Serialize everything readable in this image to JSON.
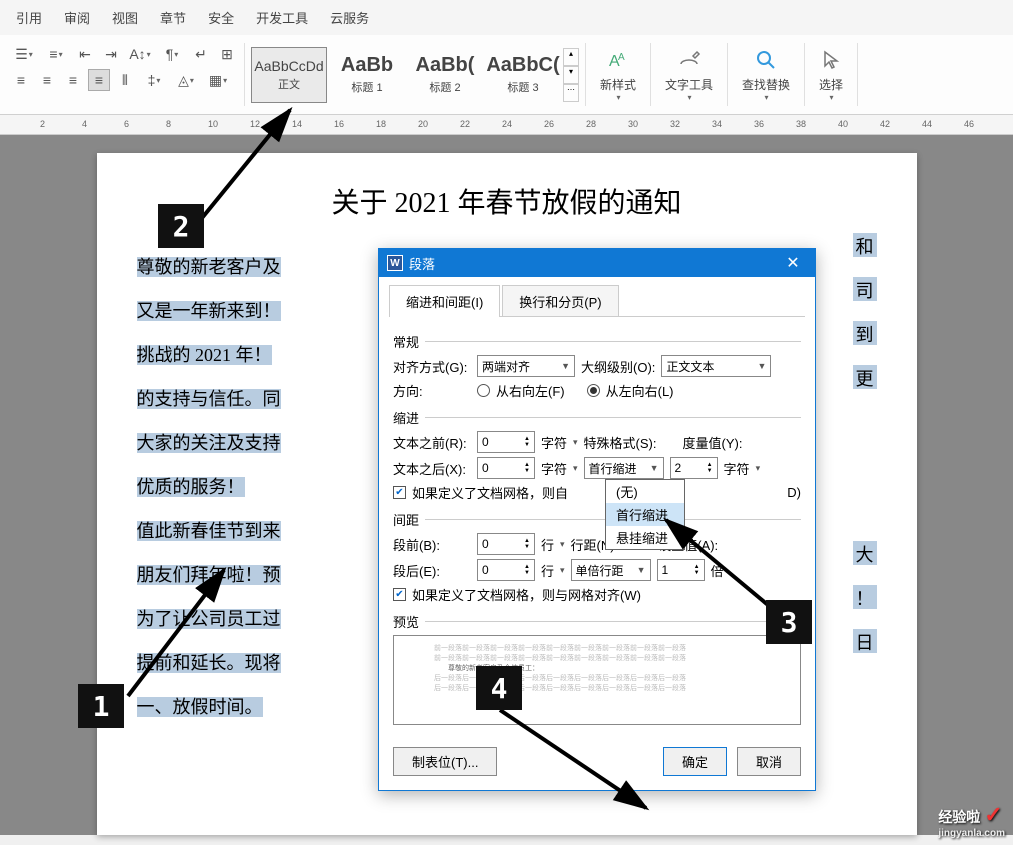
{
  "menubar": [
    "引用",
    "审阅",
    "视图",
    "章节",
    "安全",
    "开发工具",
    "云服务"
  ],
  "ribbon": {
    "styles": [
      {
        "sample": "AaBbCcDd",
        "label": "正文",
        "active": true
      },
      {
        "sample": "AaBb",
        "label": "标题 1",
        "big": true
      },
      {
        "sample": "AaBb(",
        "label": "标题 2",
        "big": true
      },
      {
        "sample": "AaBbC(",
        "label": "标题 3",
        "big": true
      }
    ],
    "new_style": "新样式",
    "text_tool": "文字工具",
    "find_replace": "查找替换",
    "select": "选择"
  },
  "ruler_ticks": [
    2,
    4,
    6,
    8,
    10,
    12,
    14,
    16,
    18,
    20,
    22,
    24,
    26,
    28,
    30,
    32,
    34,
    36,
    38,
    40,
    42,
    44,
    46
  ],
  "document": {
    "title": "关于 2021 年春节放假的通知",
    "lines": [
      "尊敬的新老客户及",
      "又是一年新来到！",
      "挑战的 2021 年！",
      "的支持与信任。同",
      "大家的关注及支持",
      "优质的服务！",
      "值此新春佳节到来",
      "朋友们拜年啦！预",
      "为了让公司员工过",
      "提前和延长。现将",
      "一、放假时间。"
    ],
    "right_chars": [
      "和",
      "司",
      "到",
      "更",
      "",
      "大",
      "！",
      "日"
    ]
  },
  "dialog": {
    "title": "段落",
    "tabs": {
      "indent": "缩进和间距(I)",
      "line": "换行和分页(P)"
    },
    "section_general": "常规",
    "align_label": "对齐方式(G):",
    "align_value": "两端对齐",
    "outline_label": "大纲级别(O):",
    "outline_value": "正文文本",
    "direction_label": "方向:",
    "rtl_label": "从右向左(F)",
    "ltr_label": "从左向右(L)",
    "section_indent": "缩进",
    "before_text_label": "文本之前(R):",
    "before_text_value": "0",
    "after_text_label": "文本之后(X):",
    "after_text_value": "0",
    "unit_char": "字符",
    "special_label": "特殊格式(S):",
    "special_value": "首行缩进",
    "measure_label": "度量值(Y):",
    "measure_value": "2",
    "auto_adjust": "如果定义了文档网格，则自",
    "auto_adjust_tail": "D)",
    "dropdown_options": [
      "(无)",
      "首行缩进",
      "悬挂缩进"
    ],
    "section_spacing": "间距",
    "before_para_label": "段前(B):",
    "before_para_value": "0",
    "after_para_label": "段后(E):",
    "after_para_value": "0",
    "unit_line": "行",
    "line_spacing_label": "行距(N):",
    "line_spacing_value": "单倍行距",
    "setvalue_label": "设置值(A):",
    "setvalue_value": "1",
    "unit_times": "倍",
    "snap_grid": "如果定义了文档网格，则与网格对齐(W)",
    "preview_label": "预览",
    "preview_text_rep": "前一段落前一段落前一段落前一段落前一段落前一段落前一段落前一段落前一段落",
    "preview_text_mid": "尊敬的新老客户及全体员工：",
    "preview_text_after": "后一段落后一段落后一段落后一段落后一段落后一段落后一段落后一段落后一段落",
    "tabstops_btn": "制表位(T)...",
    "ok_btn": "确定",
    "cancel_btn": "取消"
  },
  "callouts": {
    "1": "1",
    "2": "2",
    "3": "3",
    "4": "4"
  },
  "watermark": {
    "main": "经验啦",
    "sub": "jingyanla.com"
  }
}
